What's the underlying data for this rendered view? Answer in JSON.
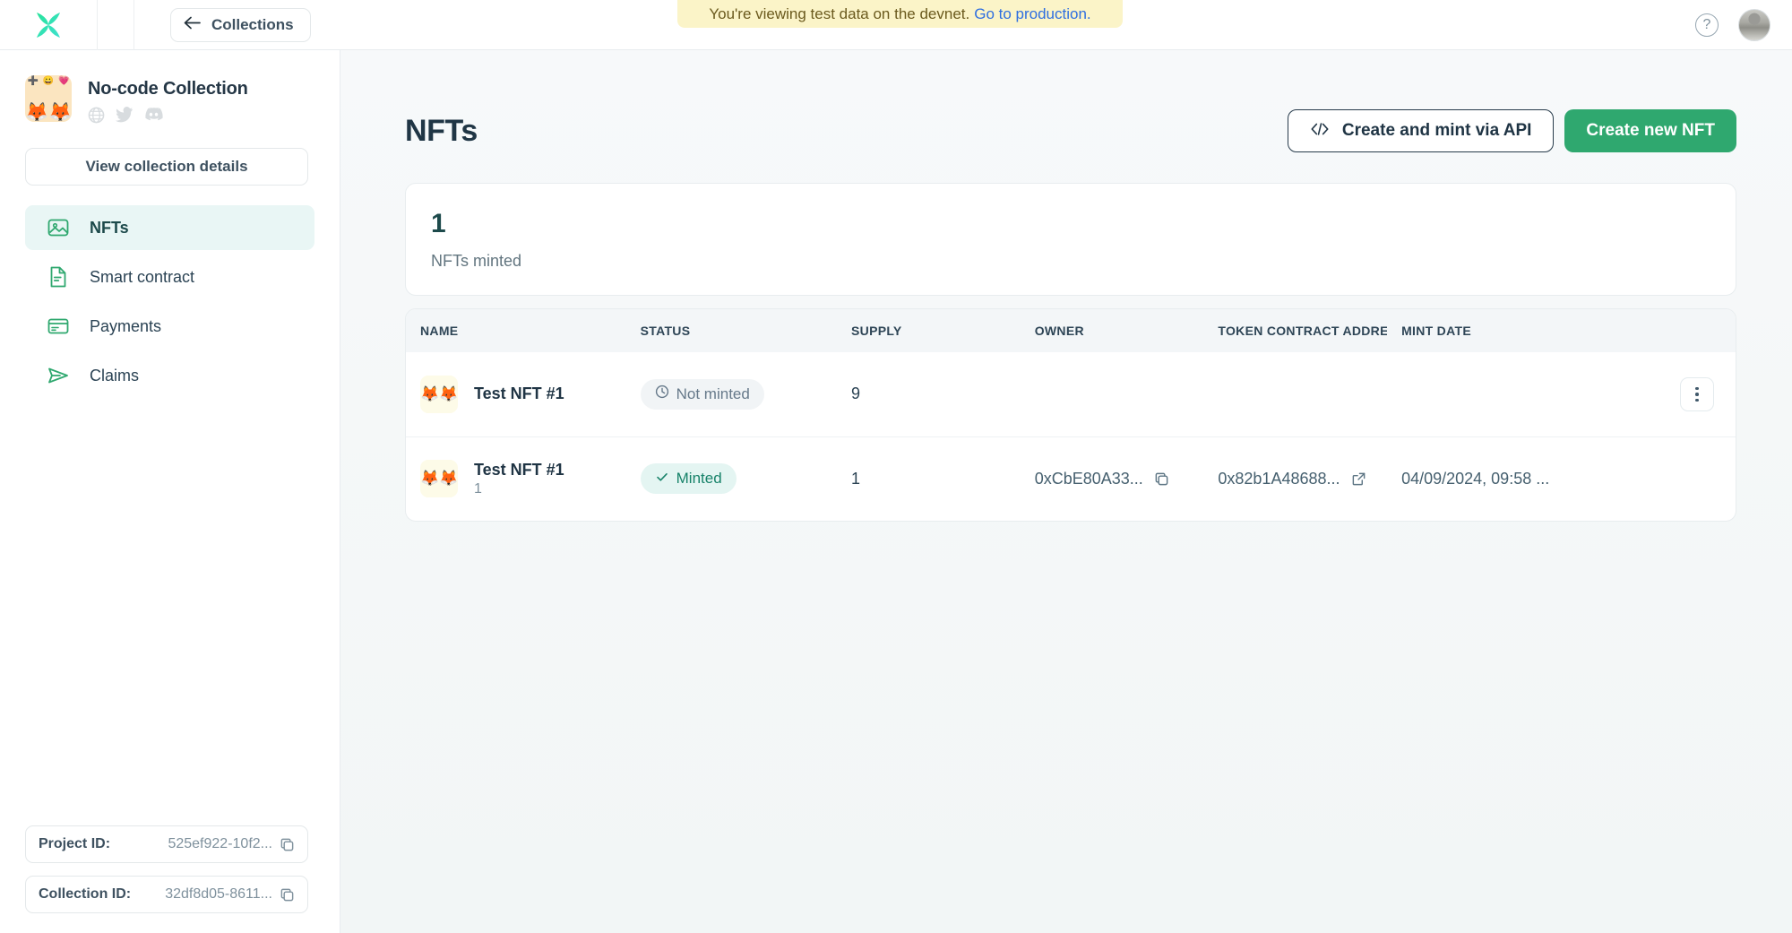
{
  "banner": {
    "message": "You're viewing test data on the devnet.",
    "link_label": "Go to production."
  },
  "topbar": {
    "back_label": "Collections",
    "help_label": "?",
    "logo_name": "x-logo"
  },
  "sidebar": {
    "collection_name": "No-code Collection",
    "socials": [
      "website",
      "twitter",
      "discord"
    ],
    "view_details_label": "View collection details",
    "items": [
      {
        "label": "NFTs",
        "icon": "image-icon",
        "active": true
      },
      {
        "label": "Smart contract",
        "icon": "document-icon",
        "active": false
      },
      {
        "label": "Payments",
        "icon": "credit-card-icon",
        "active": false
      },
      {
        "label": "Claims",
        "icon": "send-icon",
        "active": false
      }
    ],
    "project_id_label": "Project ID:",
    "project_id_value": "525ef922-10f2...",
    "collection_id_label": "Collection ID:",
    "collection_id_value": "32df8d05-8611..."
  },
  "main": {
    "title": "NFTs",
    "api_button_label": "Create and mint via API",
    "create_button_label": "Create new NFT",
    "stat_value": "1",
    "stat_label": "NFTs minted"
  },
  "table": {
    "columns": [
      "NAME",
      "STATUS",
      "SUPPLY",
      "OWNER",
      "TOKEN CONTRACT ADDRESS",
      "MINT DATE"
    ],
    "rows": [
      {
        "name": "Test NFT #1",
        "sub": "",
        "status": "Not minted",
        "status_type": "notminted",
        "supply": "9",
        "owner": "",
        "token_address": "",
        "mint_date": "",
        "has_menu": true
      },
      {
        "name": "Test NFT #1",
        "sub": "1",
        "status": "Minted",
        "status_type": "minted",
        "supply": "1",
        "owner": "0xCbE80A33...",
        "token_address": "0x82b1A48688...",
        "mint_date": "04/09/2024, 09:58 ...",
        "has_menu": false
      }
    ]
  },
  "colors": {
    "accent_green": "#2fa86f",
    "banner_bg": "#fbf4c8",
    "link_blue": "#2f6fe0",
    "active_nav_bg": "#e9f6f5"
  }
}
